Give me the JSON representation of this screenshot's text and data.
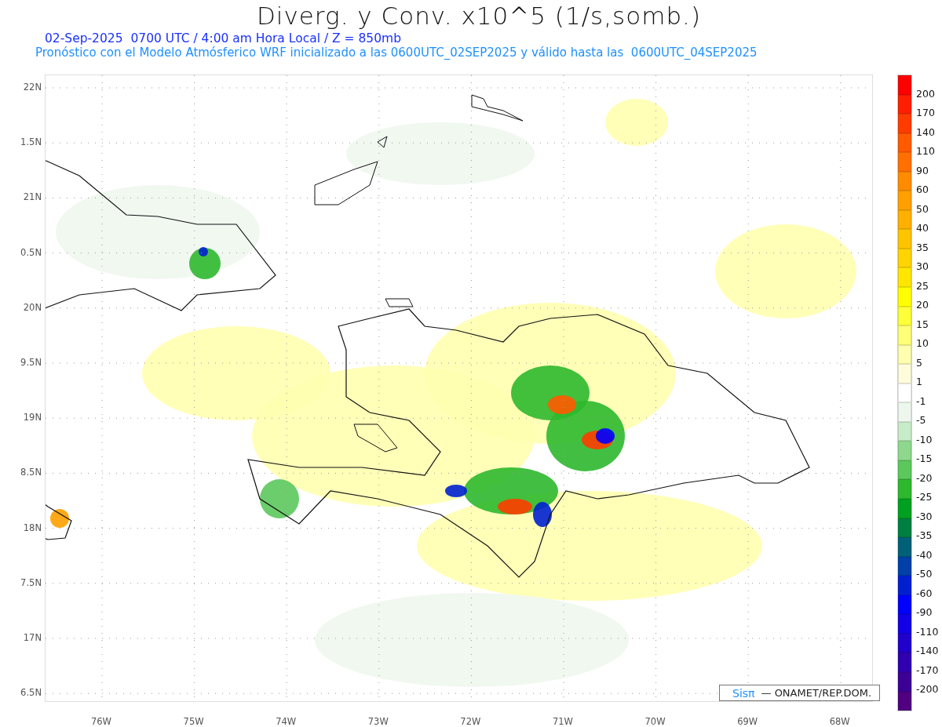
{
  "title": "Diverg. y Conv. x10^5 (1/s,somb.)",
  "subtitle": "02-Sep-2025  0700 UTC / 4:00 am Hora Local / Z = 850mb",
  "forecast_note": "Pronóstico con el Modelo Atmósferico WRF inicializado a las 0600UTC_02SEP2025 y válido hasta las  0600UTC_04SEP2025",
  "y_axis": [
    "22N",
    "1.5N",
    "21N",
    "0.5N",
    "20N",
    "9.5N",
    "19N",
    "8.5N",
    "18N",
    "7.5N",
    "17N",
    "6.5N"
  ],
  "x_axis": [
    "76W",
    "75W",
    "74W",
    "73W",
    "72W",
    "71W",
    "70W",
    "69W",
    "68W"
  ],
  "credit": {
    "brand": "Sisπ",
    "text": "— ONAMET/REP.DOM."
  },
  "colorbar": [
    {
      "color": "#ff0000",
      "label": "200"
    },
    {
      "color": "#ff1e00",
      "label": "170"
    },
    {
      "color": "#ff3c00",
      "label": "140"
    },
    {
      "color": "#ff5a00",
      "label": "110"
    },
    {
      "color": "#ff7000",
      "label": "90"
    },
    {
      "color": "#ff8c00",
      "label": "60"
    },
    {
      "color": "#ffa000",
      "label": "50"
    },
    {
      "color": "#ffb000",
      "label": "40"
    },
    {
      "color": "#ffc400",
      "label": "35"
    },
    {
      "color": "#ffd400",
      "label": "30"
    },
    {
      "color": "#ffe600",
      "label": "25"
    },
    {
      "color": "#ffff00",
      "label": "20"
    },
    {
      "color": "#ffff3a",
      "label": "15"
    },
    {
      "color": "#ffff78",
      "label": "10"
    },
    {
      "color": "#ffffb0",
      "label": "5"
    },
    {
      "color": "#fffcdc",
      "label": "1"
    },
    {
      "color": "#ffffff",
      "label": "-1"
    },
    {
      "color": "#eef7ee",
      "label": "-5"
    },
    {
      "color": "#c8ecc8",
      "label": "-10"
    },
    {
      "color": "#8ed88e",
      "label": "-15"
    },
    {
      "color": "#5cc85c",
      "label": "-20"
    },
    {
      "color": "#2db82d",
      "label": "-25"
    },
    {
      "color": "#00a020",
      "label": "-30"
    },
    {
      "color": "#008040",
      "label": "-35"
    },
    {
      "color": "#006078",
      "label": "-40"
    },
    {
      "color": "#0040a8",
      "label": "-50"
    },
    {
      "color": "#0020d0",
      "label": "-60"
    },
    {
      "color": "#0000ff",
      "label": "-90"
    },
    {
      "color": "#1400e6",
      "label": "-110"
    },
    {
      "color": "#2200cc",
      "label": "-140"
    },
    {
      "color": "#3000b0",
      "label": "-170"
    },
    {
      "color": "#3c0096",
      "label": "-200"
    },
    {
      "color": "#500080"
    }
  ]
}
